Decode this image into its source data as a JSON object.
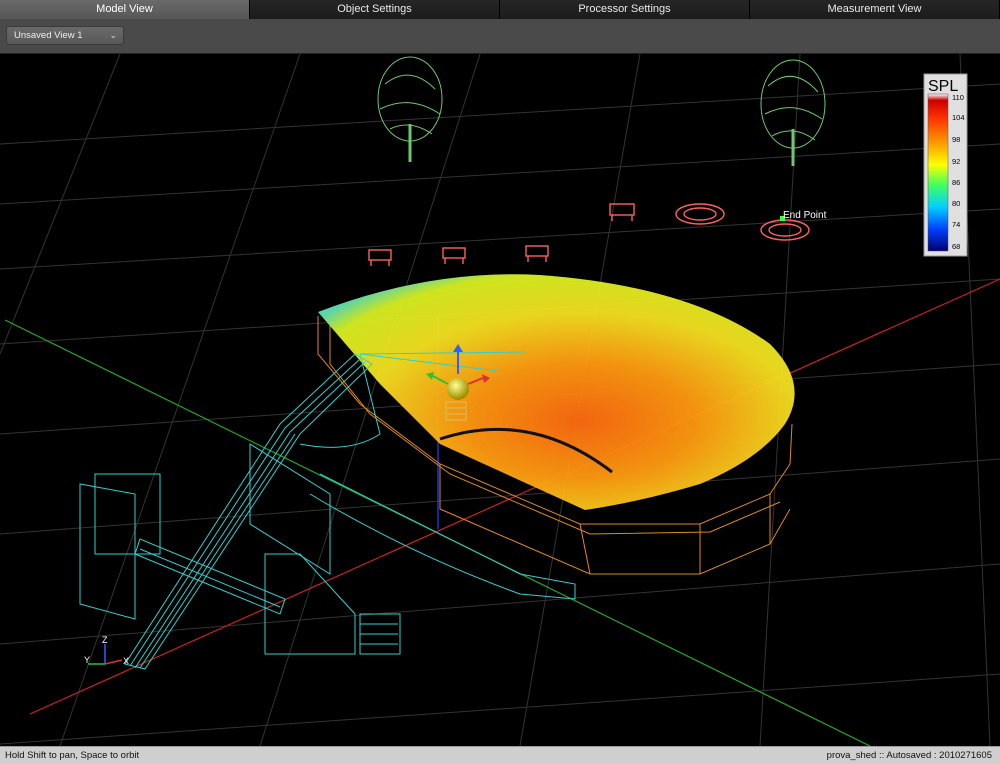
{
  "tabs": [
    {
      "label": "Model View",
      "active": true
    },
    {
      "label": "Object Settings",
      "active": false
    },
    {
      "label": "Processor Settings",
      "active": false
    },
    {
      "label": "Measurement View",
      "active": false
    }
  ],
  "toolbar": {
    "view_selector": {
      "value": "Unsaved View 1"
    }
  },
  "viewport": {
    "end_point_label": "End Point",
    "axis_labels": {
      "z": "Z",
      "y": "Y",
      "x": "X"
    },
    "spl_legend": {
      "title": "SPL",
      "ticks": [
        "110",
        "104",
        "98",
        "92",
        "86",
        "80",
        "74",
        "68"
      ],
      "colors": [
        "#ffffff",
        "#cc0000",
        "#ff4000",
        "#ffb000",
        "#ffff00",
        "#40ff60",
        "#00c0ff",
        "#0040ff",
        "#000080"
      ]
    },
    "colors": {
      "speaker_wireframe": "#2fd0d0",
      "stage_wireframe": "#e08a1a",
      "seating": "#ff6060",
      "trees": "#6ec96e",
      "grid": "#3a3a3a",
      "axis_x": "#cc2222",
      "axis_y": "#22aa22",
      "axis_z": "#2244ff"
    }
  },
  "status": {
    "hint": "Hold Shift to pan, Space to orbit",
    "autosave": "prova_shed :: Autosaved : 2010271605"
  }
}
